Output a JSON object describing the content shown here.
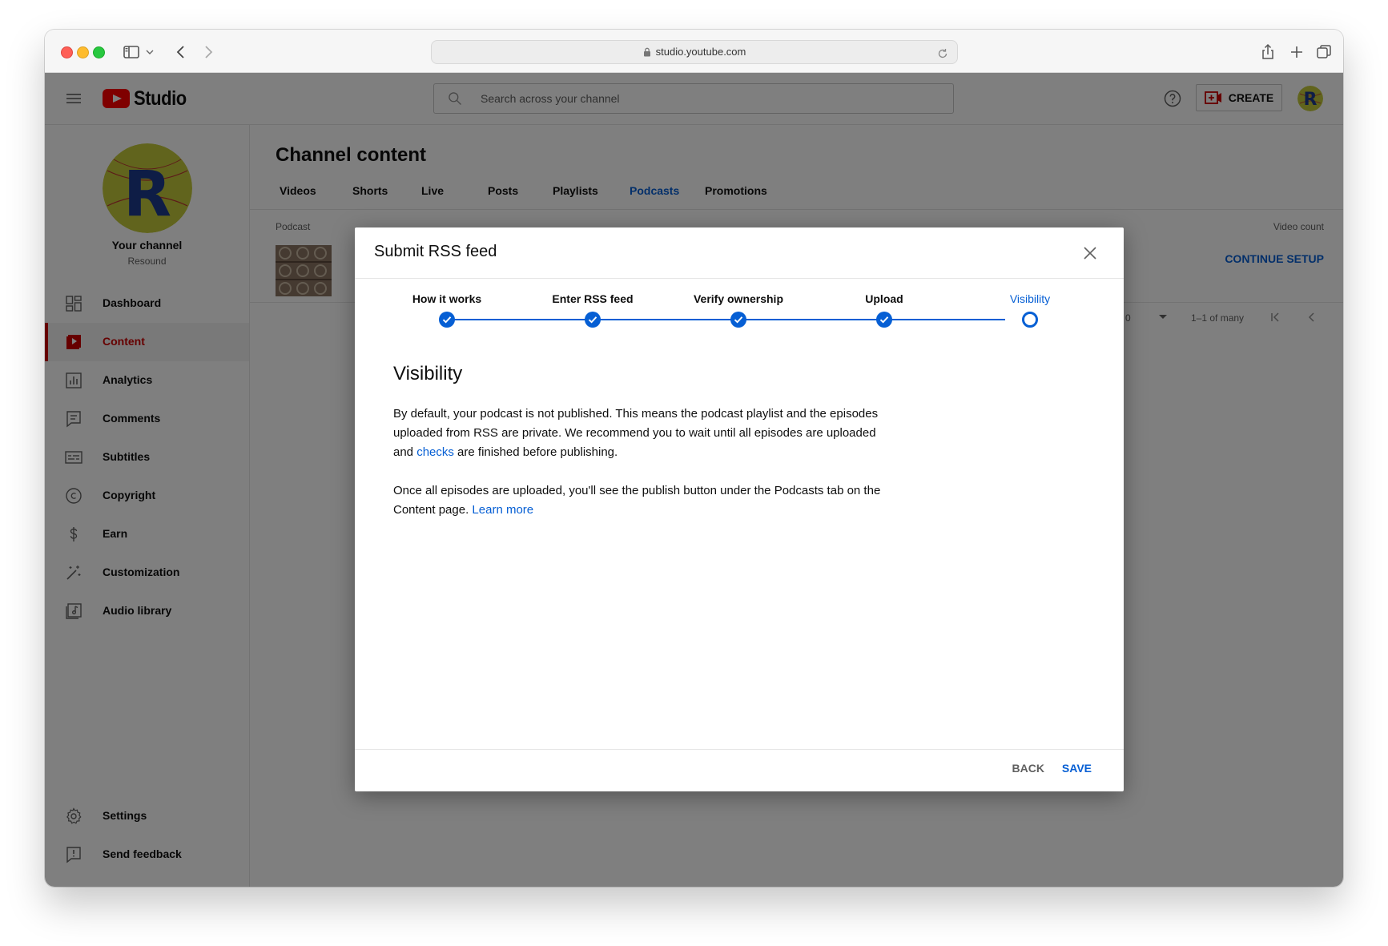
{
  "browser": {
    "url": "studio.youtube.com"
  },
  "topbar": {
    "logo_text": "Studio",
    "search_placeholder": "Search across your channel",
    "create_label": "CREATE"
  },
  "sidebar": {
    "channel_label": "Your channel",
    "channel_name": "Resound",
    "items": [
      {
        "label": "Dashboard",
        "icon": "dashboard-icon"
      },
      {
        "label": "Content",
        "icon": "content-icon",
        "active": true
      },
      {
        "label": "Analytics",
        "icon": "analytics-icon"
      },
      {
        "label": "Comments",
        "icon": "comments-icon"
      },
      {
        "label": "Subtitles",
        "icon": "subtitles-icon"
      },
      {
        "label": "Copyright",
        "icon": "copyright-icon"
      },
      {
        "label": "Earn",
        "icon": "dollar-icon"
      },
      {
        "label": "Customization",
        "icon": "magic-wand-icon"
      },
      {
        "label": "Audio library",
        "icon": "audio-library-icon"
      }
    ],
    "bottom_items": [
      {
        "label": "Settings",
        "icon": "gear-icon"
      },
      {
        "label": "Send feedback",
        "icon": "feedback-icon"
      }
    ]
  },
  "main": {
    "title": "Channel content",
    "tabs": [
      "Videos",
      "Shorts",
      "Live",
      "Posts",
      "Playlists",
      "Podcasts",
      "Promotions"
    ],
    "active_tab": "Podcasts",
    "columns": {
      "left": "Podcast",
      "right": "Video count"
    },
    "row_action": "CONTINUE SETUP",
    "pager": {
      "rows_value": "0",
      "range": "1–1 of many"
    }
  },
  "dialog": {
    "title": "Submit RSS feed",
    "steps": [
      {
        "label": "How it works",
        "state": "done"
      },
      {
        "label": "Enter RSS feed",
        "state": "done"
      },
      {
        "label": "Verify ownership",
        "state": "done"
      },
      {
        "label": "Upload",
        "state": "done"
      },
      {
        "label": "Visibility",
        "state": "current"
      }
    ],
    "heading": "Visibility",
    "para1_part1": "By default, your podcast is not published. This means the podcast playlist and the episodes uploaded from RSS are private. We recommend you to wait until all episodes are uploaded and ",
    "para1_link": "checks",
    "para1_part2": " are finished before publishing.",
    "para2_text": "Once all episodes are uploaded, you'll see the publish button under the Podcasts tab on the Content page. ",
    "para2_link": "Learn more",
    "back_label": "BACK",
    "save_label": "SAVE"
  },
  "colors": {
    "accent_blue": "#065fd4",
    "youtube_red": "#ff0000",
    "active_red": "#cc0000"
  }
}
